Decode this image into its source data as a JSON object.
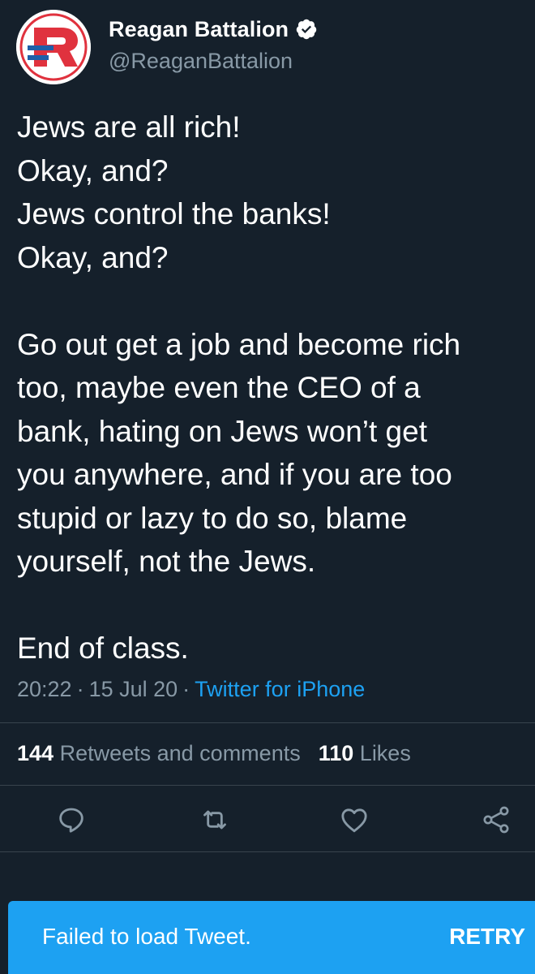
{
  "account": {
    "display_name": "Reagan Battalion",
    "handle": "@ReaganBattalion",
    "verified": true,
    "avatar_letter": "R"
  },
  "tweet": {
    "lines": [
      "Jews are all rich!",
      "Okay, and?",
      "Jews control the banks!",
      "Okay, and?",
      "",
      "Go out get a job and become rich",
      "too, maybe even the CEO of a",
      "bank, hating on Jews won’t get",
      "you anywhere, and if you are too",
      "stupid or lazy to do so, blame",
      "yourself, not the Jews.",
      "",
      "End of class."
    ],
    "time": "20:22",
    "date": "15 Jul 20",
    "separator": "·",
    "source": "Twitter for iPhone"
  },
  "stats": {
    "retweets_count": "144",
    "retweets_label": "Retweets and comments",
    "likes_count": "110",
    "likes_label": "Likes"
  },
  "actions": {
    "icons": [
      "reply-icon",
      "retweet-icon",
      "like-icon",
      "share-icon"
    ]
  },
  "toast": {
    "message": "Failed to load Tweet.",
    "action_label": "RETRY"
  },
  "colors": {
    "background": "#15202b",
    "text_primary": "#ffffff",
    "text_secondary": "#8899a6",
    "accent": "#1da1f2",
    "divider": "#38444d",
    "avatar_red": "#e0323e",
    "avatar_blue": "#1f5fa8"
  }
}
